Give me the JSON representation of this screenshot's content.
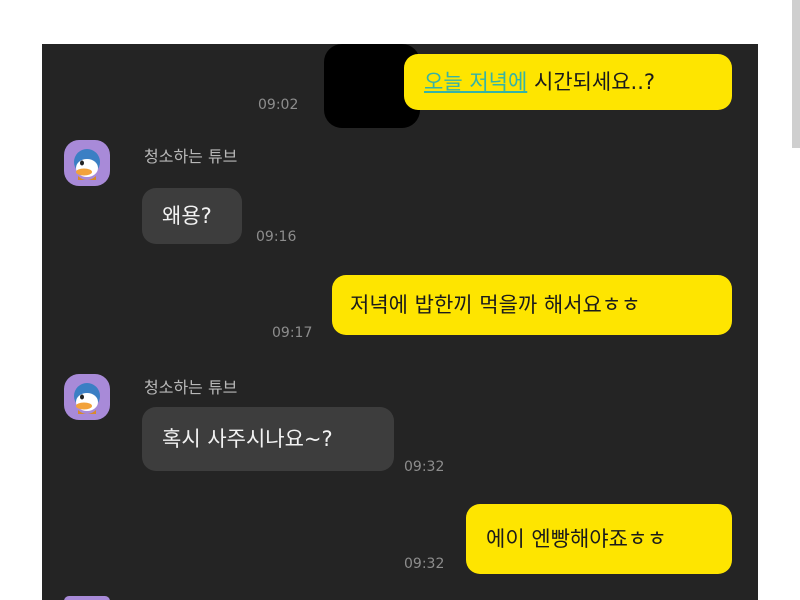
{
  "chat": {
    "messages": [
      {
        "side": "out",
        "link_text": "오늘 저녁에",
        "text": " 시간되세요..?",
        "time": "09:02"
      },
      {
        "side": "in",
        "sender": "청소하는 튜브",
        "text": "왜용?",
        "time": "09:16"
      },
      {
        "side": "out",
        "text": "저녁에 밥한끼 먹을까 해서요ㅎㅎ",
        "time": "09:17"
      },
      {
        "side": "in",
        "sender": "청소하는 튜브",
        "text": "혹시 사주시나요~?",
        "time": "09:32"
      },
      {
        "side": "out",
        "text": "에이 엔빵해야죠ㅎㅎ",
        "time": "09:32"
      }
    ]
  },
  "colors": {
    "chat_background": "#242424",
    "outgoing_bubble": "#fee500",
    "incoming_bubble": "#3d3d3d",
    "link": "#36b3a6",
    "timestamp": "#8d8d8d"
  },
  "icons": {
    "avatar": "duck-character-avatar-icon"
  }
}
